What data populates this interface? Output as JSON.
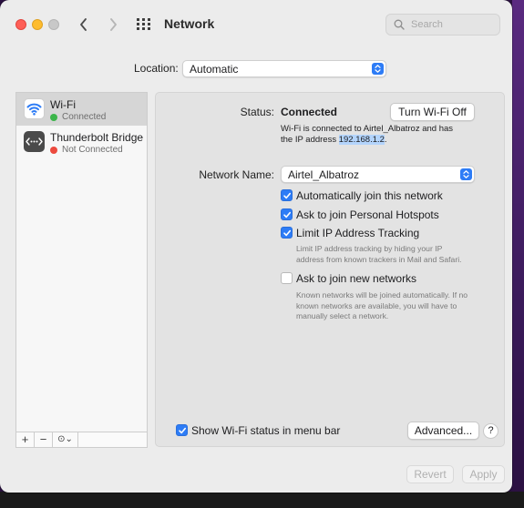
{
  "window": {
    "title": "Network"
  },
  "search": {
    "placeholder": "Search"
  },
  "location": {
    "label": "Location:",
    "value": "Automatic"
  },
  "sidebar": {
    "items": [
      {
        "name": "Wi-Fi",
        "status": "Connected",
        "status_color": "#3bb54a"
      },
      {
        "name": "Thunderbolt Bridge",
        "status": "Not Connected",
        "status_color": "#ec4a3e"
      }
    ],
    "toolbar": {
      "add": "+",
      "remove": "−",
      "action": "⊙⌄"
    }
  },
  "main": {
    "status_label": "Status:",
    "status_value": "Connected",
    "toggle_wifi_button": "Turn Wi-Fi Off",
    "status_desc_1": "Wi-Fi is connected to Airtel_Albatroz and has",
    "status_desc_2": "the IP address ",
    "ip_address": "192.168.1.2",
    "status_desc_end": ".",
    "network_name_label": "Network Name:",
    "network_name_value": "Airtel_Albatroz",
    "options": [
      {
        "label": "Automatically join this network",
        "checked": true
      },
      {
        "label": "Ask to join Personal Hotspots",
        "checked": true
      },
      {
        "label": "Limit IP Address Tracking",
        "checked": true
      },
      {
        "label": "Ask to join new networks",
        "checked": false
      }
    ],
    "limit_hint_1": "Limit IP address tracking by hiding your IP",
    "limit_hint_2": "address from known trackers in Mail and Safari.",
    "join_hint_1": "Known networks will be joined automatically. If no",
    "join_hint_2": "known networks are available, you will have to",
    "join_hint_3": "manually select a network.",
    "show_status_label": "Show Wi-Fi status in menu bar",
    "show_status_checked": true,
    "advanced_button": "Advanced...",
    "help_button": "?"
  },
  "footer": {
    "revert_button": "Revert",
    "apply_button": "Apply"
  },
  "colors": {
    "accent": "#2d7cf6",
    "close": "#fe5f57",
    "minimize": "#febc2e"
  }
}
